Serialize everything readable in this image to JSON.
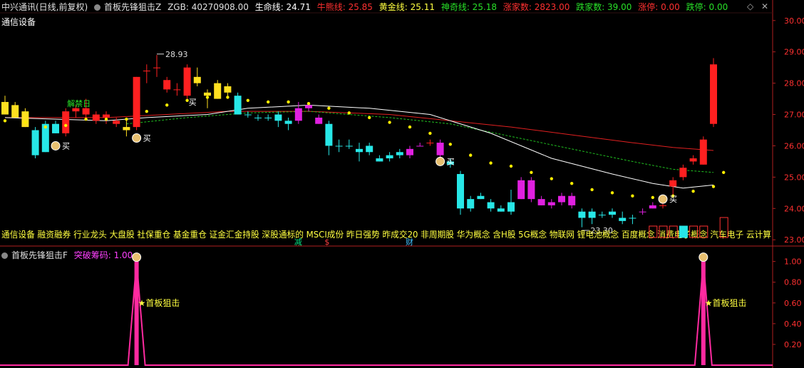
{
  "header": {
    "security": "中兴通讯(日线,前复权)",
    "indicator": "首板先锋狙击Z",
    "zgb": "ZGB: 40270908.00",
    "shengming": "生命线: 24.71",
    "niuxiong": "牛熊线: 25.85",
    "huangjin": "黄金线: 25.11",
    "shenqi": "神奇线: 25.18",
    "zhangjia": "涨家数: 2823.00",
    "diejia": "跌家数: 39.00",
    "zhangting": "涨停: 0.00",
    "dieting": "跌停: 0.00",
    "sector": "通信设备"
  },
  "header2": {
    "indicator": "首板先锋狙击F",
    "value": "突破筹码: 1.00"
  },
  "icons": {
    "settings": "gear-icon",
    "diamond": "diamond-icon",
    "close": "close-icon"
  },
  "concepts": "通信设备 融资融券 行业龙头 大盘股 社保重仓 基金重仓 证金汇金持股 深股通标的 MSCI成份 昨日强势 昨成交20 非周期股 华为概念 含H股 5G概念 物联网 锂电池概念 百度概念 消费电子概念 汽车电子 云计算",
  "concept_marks": [
    {
      "text": "减",
      "color": "#00e080",
      "cat": 29
    },
    {
      "text": "$",
      "color": "#ff4040",
      "cat": 32
    },
    {
      "text": "财",
      "color": "#40c0ff",
      "cat": 40
    }
  ],
  "colors": {
    "up": "#ff2020",
    "down": "#27e7e7",
    "limit_up": "#ffe020",
    "special": "#e020e0",
    "ma_white": "#ffffff",
    "ma_red": "#e02020",
    "ma_green": "#20c020",
    "dots": "#ffee00",
    "signal": "#ff2aa0"
  },
  "chart_data": [
    {
      "type": "candlestick",
      "x": [
        0,
        1,
        2,
        3,
        4,
        5,
        6,
        7,
        8,
        9,
        10,
        11,
        12,
        13,
        14,
        15,
        16,
        17,
        18,
        19,
        20,
        21,
        22,
        23,
        24,
        25,
        26,
        27,
        28,
        29,
        30,
        31,
        32,
        33,
        34,
        35,
        36,
        37,
        38,
        39,
        40,
        41,
        42,
        43,
        44,
        45,
        46,
        47,
        48,
        49,
        50,
        51,
        52,
        53,
        54,
        55,
        56,
        57,
        58,
        59,
        60,
        61,
        62,
        63,
        64,
        65,
        66,
        67,
        68,
        69,
        70,
        71
      ],
      "candles": [
        {
          "o": 27.4,
          "h": 27.6,
          "l": 27.0,
          "c": 27.0,
          "col": "limit_up"
        },
        {
          "o": 27.3,
          "h": 27.4,
          "l": 26.9,
          "c": 26.9,
          "col": "limit_up"
        },
        {
          "o": 27.1,
          "h": 27.2,
          "l": 26.6,
          "c": 26.6,
          "col": "limit_up"
        },
        {
          "o": 26.5,
          "h": 26.6,
          "l": 25.6,
          "c": 25.7,
          "col": "down"
        },
        {
          "o": 26.7,
          "h": 26.8,
          "l": 25.8,
          "c": 25.8,
          "col": "down"
        },
        {
          "o": 26.7,
          "h": 26.8,
          "l": 26.4,
          "c": 26.4,
          "col": "down"
        },
        {
          "o": 26.4,
          "h": 27.2,
          "l": 26.3,
          "c": 27.1,
          "col": "up"
        },
        {
          "o": 27.1,
          "h": 27.3,
          "l": 26.9,
          "c": 27.2,
          "col": "up"
        },
        {
          "o": 27.2,
          "h": 27.5,
          "l": 26.9,
          "c": 27.0,
          "col": "up"
        },
        {
          "o": 27.0,
          "h": 27.1,
          "l": 26.7,
          "c": 26.8,
          "col": "up"
        },
        {
          "o": 26.9,
          "h": 27.1,
          "l": 26.7,
          "c": 27.0,
          "col": "up"
        },
        {
          "o": 26.8,
          "h": 26.9,
          "l": 26.6,
          "c": 26.7,
          "col": "up"
        },
        {
          "o": 26.6,
          "h": 26.8,
          "l": 26.3,
          "c": 26.5,
          "col": "limit_up"
        },
        {
          "o": 26.6,
          "h": 28.2,
          "l": 26.5,
          "c": 28.2,
          "col": "up"
        },
        {
          "o": 28.4,
          "h": 28.6,
          "l": 28.0,
          "c": 28.4,
          "col": "up"
        },
        {
          "o": 28.5,
          "h": 28.9,
          "l": 28.2,
          "c": 28.5,
          "col": "up"
        },
        {
          "o": 28.1,
          "h": 28.2,
          "l": 27.7,
          "c": 27.8,
          "col": "up"
        },
        {
          "o": 27.8,
          "h": 28.0,
          "l": 27.6,
          "c": 27.8,
          "col": "up"
        },
        {
          "o": 28.5,
          "h": 28.6,
          "l": 27.5,
          "c": 27.6,
          "col": "up"
        },
        {
          "o": 28.2,
          "h": 28.5,
          "l": 27.9,
          "c": 28.0,
          "col": "limit_up"
        },
        {
          "o": 27.6,
          "h": 27.8,
          "l": 27.2,
          "c": 27.7,
          "col": "limit_up"
        },
        {
          "o": 28.0,
          "h": 28.1,
          "l": 27.5,
          "c": 27.5,
          "col": "limit_up"
        },
        {
          "o": 27.9,
          "h": 28.0,
          "l": 27.6,
          "c": 27.7,
          "col": "limit_up"
        },
        {
          "o": 27.6,
          "h": 27.7,
          "l": 27.0,
          "c": 27.0,
          "col": "down"
        },
        {
          "o": 27.0,
          "h": 27.1,
          "l": 26.9,
          "c": 27.0,
          "col": "down"
        },
        {
          "o": 26.9,
          "h": 27.0,
          "l": 26.8,
          "c": 26.9,
          "col": "down"
        },
        {
          "o": 26.9,
          "h": 27.0,
          "l": 26.8,
          "c": 26.9,
          "col": "down"
        },
        {
          "o": 27.0,
          "h": 27.1,
          "l": 26.6,
          "c": 26.8,
          "col": "down"
        },
        {
          "o": 26.8,
          "h": 26.9,
          "l": 26.5,
          "c": 26.7,
          "col": "down"
        },
        {
          "o": 27.2,
          "h": 27.4,
          "l": 26.7,
          "c": 26.8,
          "col": "special"
        },
        {
          "o": 27.3,
          "h": 27.4,
          "l": 27.1,
          "c": 27.2,
          "col": "special"
        },
        {
          "o": 26.9,
          "h": 27.0,
          "l": 26.7,
          "c": 26.7,
          "col": "special"
        },
        {
          "o": 26.7,
          "h": 26.8,
          "l": 25.7,
          "c": 26.0,
          "col": "down"
        },
        {
          "o": 26.0,
          "h": 26.2,
          "l": 25.8,
          "c": 26.0,
          "col": "down"
        },
        {
          "o": 26.0,
          "h": 26.2,
          "l": 25.9,
          "c": 26.0,
          "col": "down"
        },
        {
          "o": 25.9,
          "h": 26.1,
          "l": 25.5,
          "c": 25.8,
          "col": "down"
        },
        {
          "o": 26.0,
          "h": 26.1,
          "l": 25.7,
          "c": 25.8,
          "col": "down"
        },
        {
          "o": 25.6,
          "h": 25.7,
          "l": 25.5,
          "c": 25.5,
          "col": "down"
        },
        {
          "o": 25.6,
          "h": 25.8,
          "l": 25.5,
          "c": 25.7,
          "col": "down"
        },
        {
          "o": 25.8,
          "h": 25.9,
          "l": 25.6,
          "c": 25.7,
          "col": "down"
        },
        {
          "o": 25.9,
          "h": 26.0,
          "l": 25.6,
          "c": 25.7,
          "col": "special"
        },
        {
          "o": 26.0,
          "h": 26.1,
          "l": 26.0,
          "c": 26.0,
          "col": "special"
        },
        {
          "o": 26.1,
          "h": 26.2,
          "l": 26.0,
          "c": 26.1,
          "col": "up"
        },
        {
          "o": 26.1,
          "h": 26.2,
          "l": 25.6,
          "c": 25.7,
          "col": "special"
        },
        {
          "o": 25.5,
          "h": 25.6,
          "l": 25.3,
          "c": 25.4,
          "col": "down"
        },
        {
          "o": 25.1,
          "h": 25.2,
          "l": 23.8,
          "c": 24.0,
          "col": "down"
        },
        {
          "o": 24.3,
          "h": 24.4,
          "l": 23.9,
          "c": 24.0,
          "col": "down"
        },
        {
          "o": 24.3,
          "h": 24.5,
          "l": 24.3,
          "c": 24.4,
          "col": "down"
        },
        {
          "o": 24.2,
          "h": 24.3,
          "l": 23.9,
          "c": 24.0,
          "col": "down"
        },
        {
          "o": 24.0,
          "h": 24.1,
          "l": 23.9,
          "c": 23.9,
          "col": "down"
        },
        {
          "o": 24.2,
          "h": 24.6,
          "l": 23.8,
          "c": 23.9,
          "col": "down"
        },
        {
          "o": 24.9,
          "h": 25.0,
          "l": 24.3,
          "c": 24.3,
          "col": "special"
        },
        {
          "o": 24.9,
          "h": 25.0,
          "l": 24.2,
          "c": 24.3,
          "col": "special"
        },
        {
          "o": 24.3,
          "h": 24.4,
          "l": 24.1,
          "c": 24.1,
          "col": "special"
        },
        {
          "o": 24.2,
          "h": 24.3,
          "l": 24.0,
          "c": 24.1,
          "col": "special"
        },
        {
          "o": 24.4,
          "h": 24.5,
          "l": 24.1,
          "c": 24.2,
          "col": "special"
        },
        {
          "o": 24.4,
          "h": 24.5,
          "l": 24.0,
          "c": 24.1,
          "col": "special"
        },
        {
          "o": 23.9,
          "h": 24.0,
          "l": 23.4,
          "c": 23.7,
          "col": "down"
        },
        {
          "o": 23.9,
          "h": 24.0,
          "l": 23.5,
          "c": 23.7,
          "col": "down"
        },
        {
          "o": 23.8,
          "h": 23.9,
          "l": 23.7,
          "c": 23.8,
          "col": "down"
        },
        {
          "o": 23.9,
          "h": 24.0,
          "l": 23.7,
          "c": 23.8,
          "col": "down"
        },
        {
          "o": 23.7,
          "h": 23.9,
          "l": 23.5,
          "c": 23.6,
          "col": "down"
        },
        {
          "o": 23.7,
          "h": 23.8,
          "l": 23.5,
          "c": 23.7,
          "col": "down"
        },
        {
          "o": 23.9,
          "h": 24.0,
          "l": 23.8,
          "c": 23.9,
          "col": "special"
        },
        {
          "o": 24.1,
          "h": 24.2,
          "l": 24.0,
          "c": 24.0,
          "col": "special"
        },
        {
          "o": 24.1,
          "h": 24.2,
          "l": 24.0,
          "c": 24.1,
          "col": "up"
        },
        {
          "o": 24.7,
          "h": 25.0,
          "l": 24.4,
          "c": 24.9,
          "col": "up"
        },
        {
          "o": 25.0,
          "h": 25.4,
          "l": 24.9,
          "c": 25.3,
          "col": "up"
        },
        {
          "o": 25.5,
          "h": 25.7,
          "l": 25.4,
          "c": 25.6,
          "col": "up"
        },
        {
          "o": 25.4,
          "h": 26.3,
          "l": 25.4,
          "c": 26.2,
          "col": "up"
        },
        {
          "o": 26.7,
          "h": 28.8,
          "l": 26.6,
          "c": 28.6,
          "col": "up"
        },
        {
          "o": 28.6,
          "h": 28.6,
          "l": 28.6,
          "c": 28.6,
          "col": "none"
        }
      ],
      "ma_white": [
        [
          0,
          26.9
        ],
        [
          10,
          26.8
        ],
        [
          14,
          26.9
        ],
        [
          20,
          27.0
        ],
        [
          24,
          27.2
        ],
        [
          30,
          27.3
        ],
        [
          36,
          27.2
        ],
        [
          42,
          27.0
        ],
        [
          48,
          26.4
        ],
        [
          54,
          25.6
        ],
        [
          60,
          25.1
        ],
        [
          64,
          24.8
        ],
        [
          67,
          24.65
        ],
        [
          70,
          24.75
        ]
      ],
      "ma_red": [
        [
          0,
          26.9
        ],
        [
          10,
          26.9
        ],
        [
          16,
          27.0
        ],
        [
          22,
          27.1
        ],
        [
          30,
          27.1
        ],
        [
          38,
          27.0
        ],
        [
          44,
          26.8
        ],
        [
          50,
          26.6
        ],
        [
          56,
          26.35
        ],
        [
          62,
          26.1
        ],
        [
          66,
          25.95
        ],
        [
          70,
          25.85
        ]
      ],
      "ma_green": [
        [
          12,
          26.7
        ],
        [
          18,
          26.9
        ],
        [
          24,
          27.05
        ],
        [
          30,
          27.1
        ],
        [
          38,
          26.9
        ],
        [
          44,
          26.7
        ],
        [
          50,
          26.3
        ],
        [
          56,
          25.9
        ],
        [
          62,
          25.5
        ],
        [
          66,
          25.25
        ],
        [
          70,
          25.15
        ]
      ],
      "dots": [
        [
          0,
          26.8
        ],
        [
          2,
          26.75
        ],
        [
          4,
          26.6
        ],
        [
          6,
          26.65
        ],
        [
          8,
          26.85
        ],
        [
          10,
          26.85
        ],
        [
          12,
          26.85
        ],
        [
          14,
          27.1
        ],
        [
          16,
          27.3
        ],
        [
          18,
          27.45
        ],
        [
          20,
          27.55
        ],
        [
          22,
          27.55
        ],
        [
          24,
          27.45
        ],
        [
          26,
          27.4
        ],
        [
          28,
          27.4
        ],
        [
          30,
          27.35
        ],
        [
          32,
          27.2
        ],
        [
          34,
          27.05
        ],
        [
          36,
          26.9
        ],
        [
          38,
          26.75
        ],
        [
          40,
          26.6
        ],
        [
          42,
          26.4
        ],
        [
          44,
          26.05
        ],
        [
          46,
          25.7
        ],
        [
          48,
          25.45
        ],
        [
          50,
          25.35
        ],
        [
          52,
          25.15
        ],
        [
          54,
          24.95
        ],
        [
          56,
          24.8
        ],
        [
          58,
          24.6
        ],
        [
          60,
          24.5
        ],
        [
          62,
          24.4
        ],
        [
          64,
          24.35
        ],
        [
          66,
          24.4
        ],
        [
          68,
          24.55
        ],
        [
          70,
          24.7
        ],
        [
          71,
          25.15
        ]
      ],
      "annotations": [
        {
          "text": "解禁日",
          "cat": 6,
          "price": 27.35,
          "color": "#28e028"
        },
        {
          "text": "28.93",
          "cat": 15,
          "price": 28.93,
          "color": "#dddddd",
          "arrow": true
        },
        {
          "text": "23.30",
          "cat": 57,
          "price": 23.3,
          "color": "#dddddd",
          "arrow": true
        },
        {
          "text": "买",
          "cat": 5,
          "price": 26.0,
          "color": "#ffffff",
          "bag": true
        },
        {
          "text": "买",
          "cat": 13,
          "price": 26.25,
          "color": "#ffffff",
          "bag": true
        },
        {
          "text": "买",
          "cat": 18,
          "price": 27.4,
          "color": "#ffffff",
          "bag": false
        },
        {
          "text": "买",
          "cat": 43,
          "price": 25.5,
          "color": "#ffffff",
          "bag": true
        },
        {
          "text": "买",
          "cat": 65,
          "price": 24.3,
          "color": "#ffffff",
          "bag": true
        }
      ],
      "ylim": [
        22.8,
        30.2
      ],
      "yticks": [
        "23.00",
        "24.00",
        "25.00",
        "26.00",
        "27.00",
        "28.00",
        "29.00",
        "30.00"
      ]
    },
    {
      "type": "line",
      "name": "突破筹码",
      "spikes": [
        13,
        69
      ],
      "labels": [
        {
          "text": "首板狙击",
          "cat": 13
        },
        {
          "text": "首板狙击",
          "cat": 69
        }
      ],
      "ylim": [
        0,
        1.08
      ],
      "yticks": [
        "0.20",
        "0.40",
        "0.60",
        "0.80",
        "1.00"
      ]
    }
  ]
}
